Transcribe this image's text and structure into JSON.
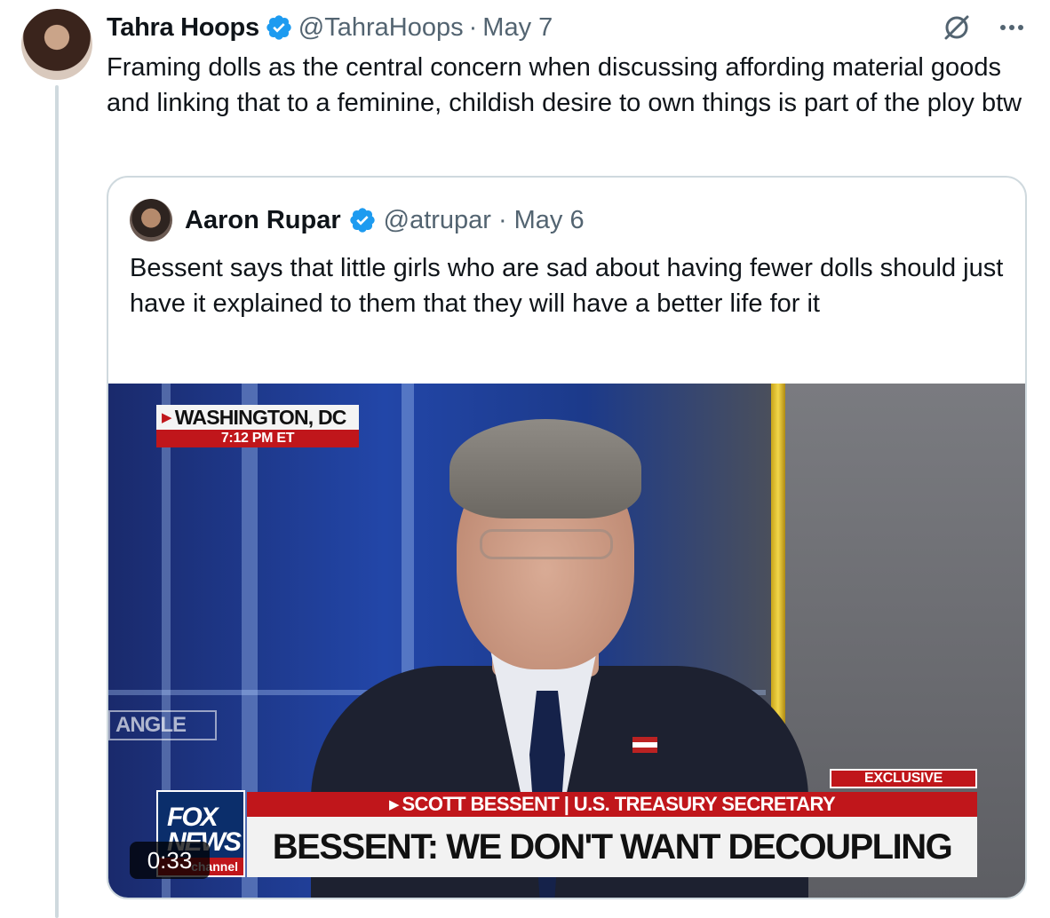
{
  "tweet": {
    "name": "Tahra Hoops",
    "handle": "@TahraHoops",
    "separator": "·",
    "date": "May 7",
    "text": "Framing dolls as the central concern when discussing affording material goods and linking that to a feminine, childish desire to own things is part of the ploy btw",
    "icons": {
      "verified": "verified-badge-icon",
      "grok": "grok-icon",
      "more": "more-icon"
    },
    "colors": {
      "verified": "#1d9bf0",
      "secondary_text": "#536471",
      "border": "#cfd9de"
    }
  },
  "quote": {
    "name": "Aaron Rupar",
    "handle": "@atrupar",
    "separator": "·",
    "date": "May 6",
    "text": "Bessent says that little girls who are sad about having fewer dolls should just have it explained to them that they will have a better life for it",
    "video": {
      "location": "WASHINGTON, DC",
      "time": "7:12 PM ET",
      "wall_sign": "ANGLE",
      "exclusive": "EXCLUSIVE",
      "subtitle": "SCOTT BESSENT | U.S. TREASURY SECRETARY",
      "headline": "BESSENT: WE DON'T WANT DECOUPLING",
      "logo_line1": "FOX",
      "logo_line2": "NEWS",
      "logo_line3": "channel",
      "duration": "0:33"
    }
  }
}
